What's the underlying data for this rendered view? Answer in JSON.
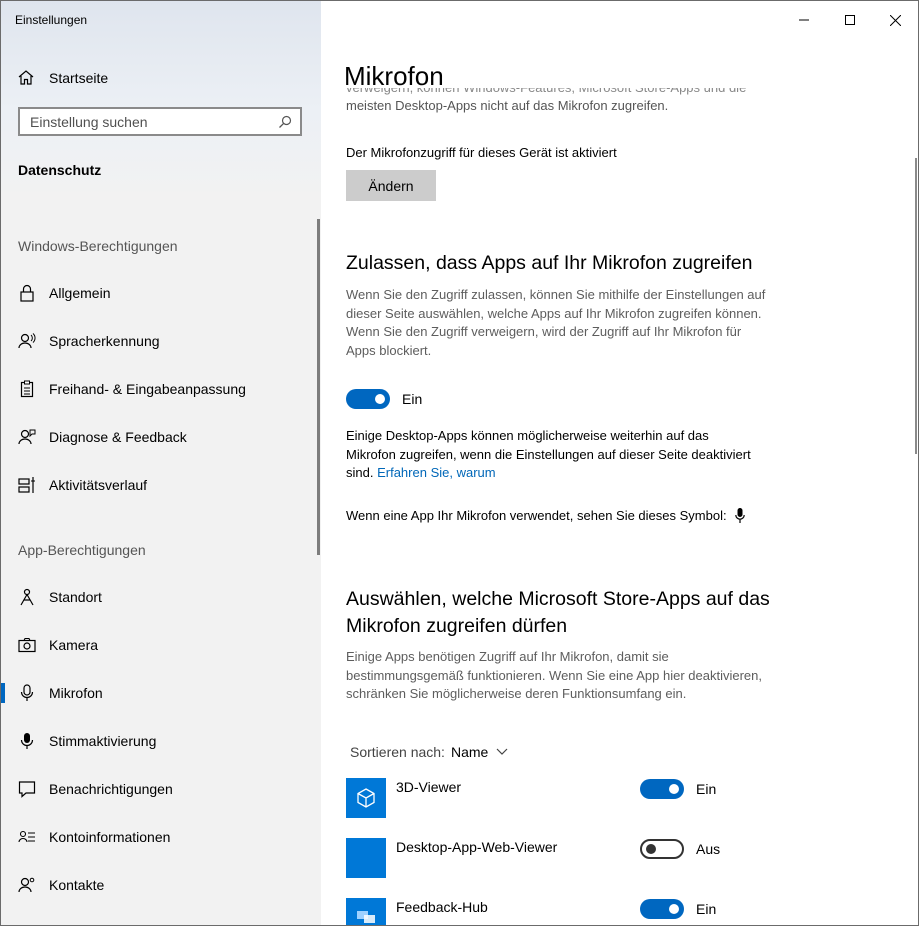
{
  "window": {
    "title": "Einstellungen"
  },
  "sidebar": {
    "home_label": "Startseite",
    "search_placeholder": "Einstellung suchen",
    "section_title": "Datenschutz",
    "windows_group_label": "Windows-Berechtigungen",
    "windows_items": [
      {
        "label": "Allgemein",
        "icon": "lock-icon"
      },
      {
        "label": "Spracherkennung",
        "icon": "speech-icon"
      },
      {
        "label": "Freihand- & Eingabeanpassung",
        "icon": "clipboard-icon"
      },
      {
        "label": "Diagnose & Feedback",
        "icon": "feedback-icon"
      },
      {
        "label": "Aktivitätsverlauf",
        "icon": "timeline-icon"
      }
    ],
    "app_group_label": "App-Berechtigungen",
    "app_items": [
      {
        "label": "Standort",
        "icon": "location-icon"
      },
      {
        "label": "Kamera",
        "icon": "camera-icon"
      },
      {
        "label": "Mikrofon",
        "icon": "microphone-icon",
        "selected": true
      },
      {
        "label": "Stimmaktivierung",
        "icon": "voice-activation-icon"
      },
      {
        "label": "Benachrichtigungen",
        "icon": "notification-icon"
      },
      {
        "label": "Kontoinformationen",
        "icon": "account-info-icon"
      },
      {
        "label": "Kontakte",
        "icon": "contacts-icon"
      }
    ]
  },
  "main": {
    "title": "Mikrofon",
    "clipped_text_top": "verweigern, können Windows-Features, Microsoft Store-Apps und die",
    "clipped_text_bottom": "meisten Desktop-Apps nicht auf das Mikrofon zugreifen.",
    "device_access_status": "Der Mikrofonzugriff für dieses Gerät ist aktiviert",
    "change_button": "Ändern",
    "allow_heading": "Zulassen, dass Apps auf Ihr Mikrofon zugreifen",
    "allow_desc_lines": [
      "Wenn Sie den Zugriff zulassen, können Sie mithilfe der Einstellungen auf",
      "dieser Seite auswählen, welche Apps auf Ihr Mikrofon zugreifen können.",
      "Wenn Sie den Zugriff verweigern, wird der Zugriff auf Ihr Mikrofon für",
      "Apps blockiert."
    ],
    "allow_toggle": {
      "state": "on",
      "label": "Ein"
    },
    "desktop_note_lines": [
      "Einige Desktop-Apps können möglicherweise weiterhin auf das",
      "Mikrofon zugreifen, wenn die Einstellungen auf dieser Seite deaktiviert",
      "sind."
    ],
    "learn_more_link": "Erfahren Sie, warum",
    "symbol_note": "Wenn eine App Ihr Mikrofon verwendet, sehen Sie dieses Symbol:",
    "store_heading_lines": [
      "Auswählen, welche Microsoft Store-Apps auf das",
      "Mikrofon zugreifen dürfen"
    ],
    "store_desc_lines": [
      "Einige Apps benötigen Zugriff auf Ihr Mikrofon, damit sie",
      "bestimmungsgemäß funktionieren. Wenn Sie eine App hier deaktivieren,",
      "schränken Sie möglicherweise deren Funktionsumfang ein."
    ],
    "sort_label": "Sortieren nach:",
    "sort_value": "Name",
    "apps": [
      {
        "name": "3D-Viewer",
        "state": "on",
        "state_label": "Ein",
        "icon": "3d-cube-icon"
      },
      {
        "name": "Desktop-App-Web-Viewer",
        "state": "off",
        "state_label": "Aus",
        "icon": "blank-tile-icon"
      },
      {
        "name": "Feedback-Hub",
        "state": "on",
        "state_label": "Ein",
        "icon": "feedback-hub-icon"
      }
    ]
  },
  "colors": {
    "accent": "#0067c0",
    "tile": "#0078d7",
    "sidebar_bg": "#f2f2f2"
  }
}
